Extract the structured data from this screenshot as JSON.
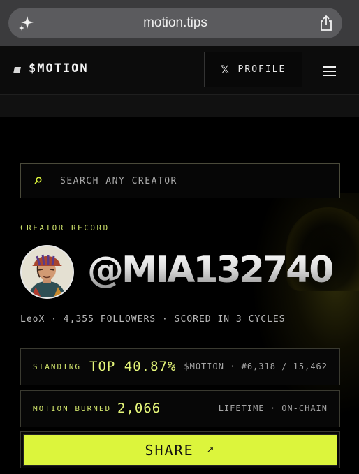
{
  "browser": {
    "url": "motion.tips"
  },
  "header": {
    "logo_text": "$MOTION",
    "profile_label": "PROFILE"
  },
  "search": {
    "placeholder": "SEARCH ANY CREATOR"
  },
  "creator": {
    "section_label": "CREATOR RECORD",
    "handle": "@MIA132740",
    "meta": "LeoX · 4,355 FOLLOWERS · SCORED IN 3 CYCLES"
  },
  "standing": {
    "label": "STANDING",
    "value": "TOP 40.87%",
    "meta": "$MOTION · #6,318 / 15,462"
  },
  "burned": {
    "label": "MOTION BURNED",
    "value": "2,066",
    "meta": "LIFETIME · ON-CHAIN"
  },
  "share": {
    "label": "SHARE"
  },
  "colors": {
    "accent": "#dcf53c",
    "label_green": "#cde06a",
    "background": "#000000"
  },
  "icons": [
    "sparkle-icon",
    "browser-share-icon",
    "x-logo-icon",
    "menu-icon",
    "search-icon",
    "arrow-up-right-icon"
  ]
}
